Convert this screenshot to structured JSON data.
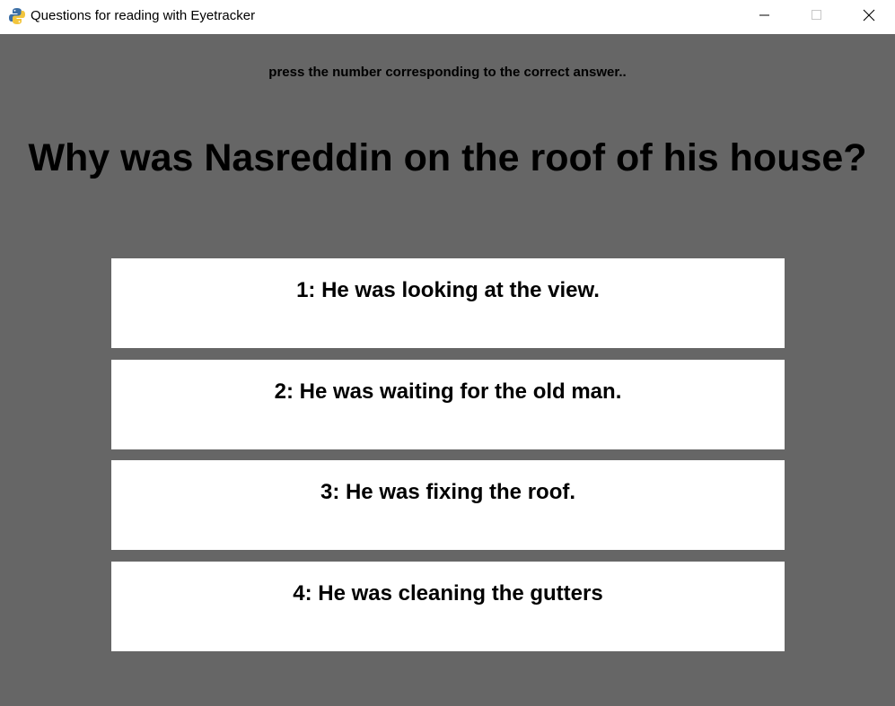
{
  "window": {
    "title": "Questions for reading with Eyetracker",
    "app_icon": "python-icon",
    "controls": [
      "minimize-icon",
      "maximize-icon",
      "close-icon"
    ]
  },
  "screen": {
    "background_color": "#666666",
    "instruction": "press the number corresponding to the correct answer..",
    "question": "Why was Nasreddin on the roof of his house?",
    "answers": [
      {
        "label": "1: He was looking at the view."
      },
      {
        "label": "2: He was waiting for the old man."
      },
      {
        "label": "3: He was fixing the roof."
      },
      {
        "label": "4: He was cleaning the gutters"
      }
    ]
  }
}
